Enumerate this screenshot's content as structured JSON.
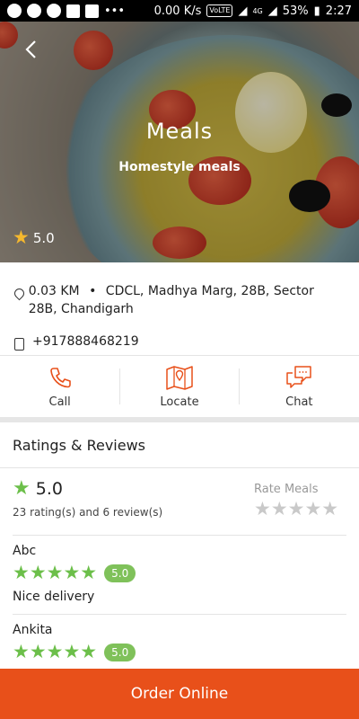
{
  "status_bar": {
    "speed": "0.00 K/s",
    "network": "VoLTE",
    "net_gen": "4G",
    "battery": "53%",
    "time": "2:27"
  },
  "header": {
    "title": "Meals",
    "subtitle": "Homestyle meals",
    "rating": "5.0"
  },
  "info": {
    "distance": "0.03 KM",
    "separator": "•",
    "address": "CDCL, Madhya Marg, 28B, Sector 28B, Chandigarh",
    "phone": "+917888468219"
  },
  "actions": {
    "call": "Call",
    "locate": "Locate",
    "chat": "Chat"
  },
  "ratings": {
    "title": "Ratings & Reviews",
    "score": "5.0",
    "count_text": "23 rating(s) and 6 review(s)",
    "rate_label": "Rate Meals",
    "rate_stars": "★★★★★"
  },
  "reviews": [
    {
      "name": "Abc",
      "stars": "★★★★★",
      "rating": "5.0",
      "comment": "Nice delivery"
    },
    {
      "name": "Ankita",
      "stars": "★★★★★",
      "rating": "5.0",
      "comment": ""
    }
  ],
  "cta": {
    "label": "Order Online"
  },
  "colors": {
    "accent": "#e8501a",
    "rating_green": "#6cbf4a",
    "hero_star": "#f5b82e"
  }
}
